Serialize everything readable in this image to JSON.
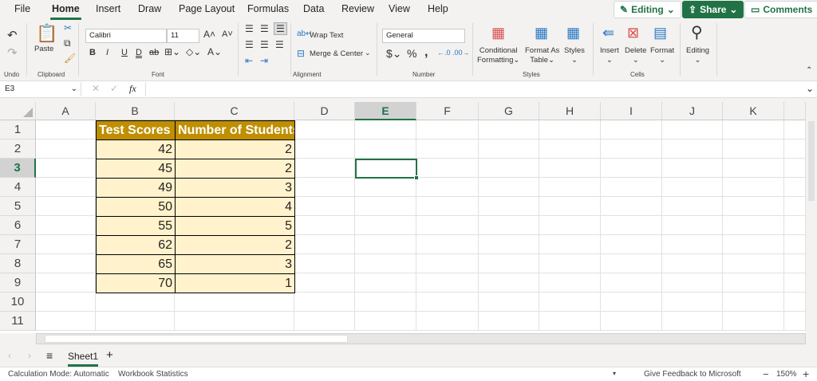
{
  "menu": [
    "File",
    "Home",
    "Insert",
    "Draw",
    "Page Layout",
    "Formulas",
    "Data",
    "Review",
    "View",
    "Help"
  ],
  "top_buttons": {
    "editing": "Editing",
    "share": "Share",
    "comments": "Comments"
  },
  "ribbon": {
    "undo_group": "Undo",
    "clipboard_group": "Clipboard",
    "paste": "Paste",
    "font_name": "Calibri",
    "font_size": "11",
    "font_group": "Font",
    "wrap_text": "Wrap Text",
    "merge_center": "Merge & Center",
    "alignment_group": "Alignment",
    "number_format": "General",
    "number_group": "Number",
    "conditional_1": "Conditional",
    "conditional_2": "Formatting",
    "format_as_1": "Format As",
    "format_as_2": "Table",
    "styles": "Styles",
    "styles_group": "Styles",
    "insert": "Insert",
    "delete": "Delete",
    "format": "Format",
    "cells_group": "Cells",
    "editing": "Editing"
  },
  "formula_bar": {
    "name_box": "E3",
    "fx": "fx",
    "value": ""
  },
  "columns": [
    "A",
    "B",
    "C",
    "D",
    "E",
    "F",
    "G",
    "H",
    "I",
    "J",
    "K"
  ],
  "rows": [
    "1",
    "2",
    "3",
    "4",
    "5",
    "6",
    "7",
    "8",
    "9",
    "10",
    "11"
  ],
  "selected_cell": "E3",
  "table": {
    "headers": [
      "Test Scores",
      "Number of Students"
    ],
    "rows": [
      [
        "42",
        "2"
      ],
      [
        "45",
        "2"
      ],
      [
        "49",
        "3"
      ],
      [
        "50",
        "4"
      ],
      [
        "55",
        "5"
      ],
      [
        "62",
        "2"
      ],
      [
        "65",
        "3"
      ],
      [
        "70",
        "1"
      ]
    ]
  },
  "sheet_tabs": [
    "Sheet1"
  ],
  "status": {
    "calc_mode": "Calculation Mode: Automatic",
    "stats": "Workbook Statistics",
    "feedback": "Give Feedback to Microsoft",
    "zoom": "150%"
  },
  "colors": {
    "accent": "#217346",
    "header_fill": "#BF8F00",
    "body_fill": "#FFF2CC"
  }
}
